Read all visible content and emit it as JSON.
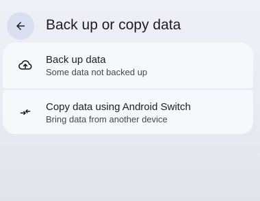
{
  "header": {
    "back_icon": "arrow-back-icon",
    "title": "Back up or copy data"
  },
  "options": [
    {
      "icon": "cloud-upload-icon",
      "title": "Back up data",
      "subtitle": "Some data not backed up"
    },
    {
      "icon": "swap-arrows-icon",
      "title": "Copy data using Android Switch",
      "subtitle": "Bring data from another device"
    }
  ],
  "colors": {
    "background": "#eceef5",
    "card": "#f7f8fc",
    "back_button": "#d9def0",
    "text_primary": "#1c1d22",
    "text_secondary": "#45474f"
  }
}
